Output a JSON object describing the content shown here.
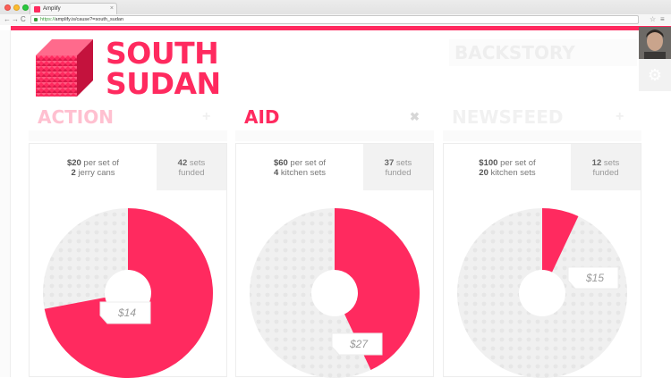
{
  "browser": {
    "tab_title": "Amplify",
    "tab_close": "×",
    "back": "←",
    "forward": "→",
    "reload": "C",
    "url_scheme": "https://",
    "url_host": "amplify.is",
    "url_rest": "/cause?=south_sudan",
    "star": "☆",
    "menu": "≡"
  },
  "page": {
    "title_line1": "SOUTH",
    "title_line2": "SUDAN",
    "backstory": "BACKSTORY",
    "accent_color": "#ff2a5f",
    "settings_icon": "⚙"
  },
  "sections": [
    {
      "title": "ACTION",
      "icon": "+"
    },
    {
      "title": "AID",
      "icon": "✖"
    },
    {
      "title": "NEWSFEED",
      "icon": "+"
    }
  ],
  "cards": [
    {
      "price_amount": "$20",
      "price_per": " per set of",
      "price_qty": "2",
      "price_item": " jerry cans",
      "funded_count": "42",
      "funded_word": " sets",
      "funded_label": "funded",
      "progress": 0.72,
      "tooltip": "$14"
    },
    {
      "price_amount": "$60",
      "price_per": " per set of",
      "price_qty": "4",
      "price_item": " kitchen sets",
      "funded_count": "37",
      "funded_word": " sets",
      "funded_label": "funded",
      "progress": 0.43,
      "tooltip": "$27"
    },
    {
      "price_amount": "$100",
      "price_per": " per set of",
      "price_qty": "20",
      "price_item": " kitchen sets",
      "funded_count": "12",
      "funded_word": " sets",
      "funded_label": "funded",
      "progress": 0.07,
      "tooltip": "$15"
    }
  ]
}
